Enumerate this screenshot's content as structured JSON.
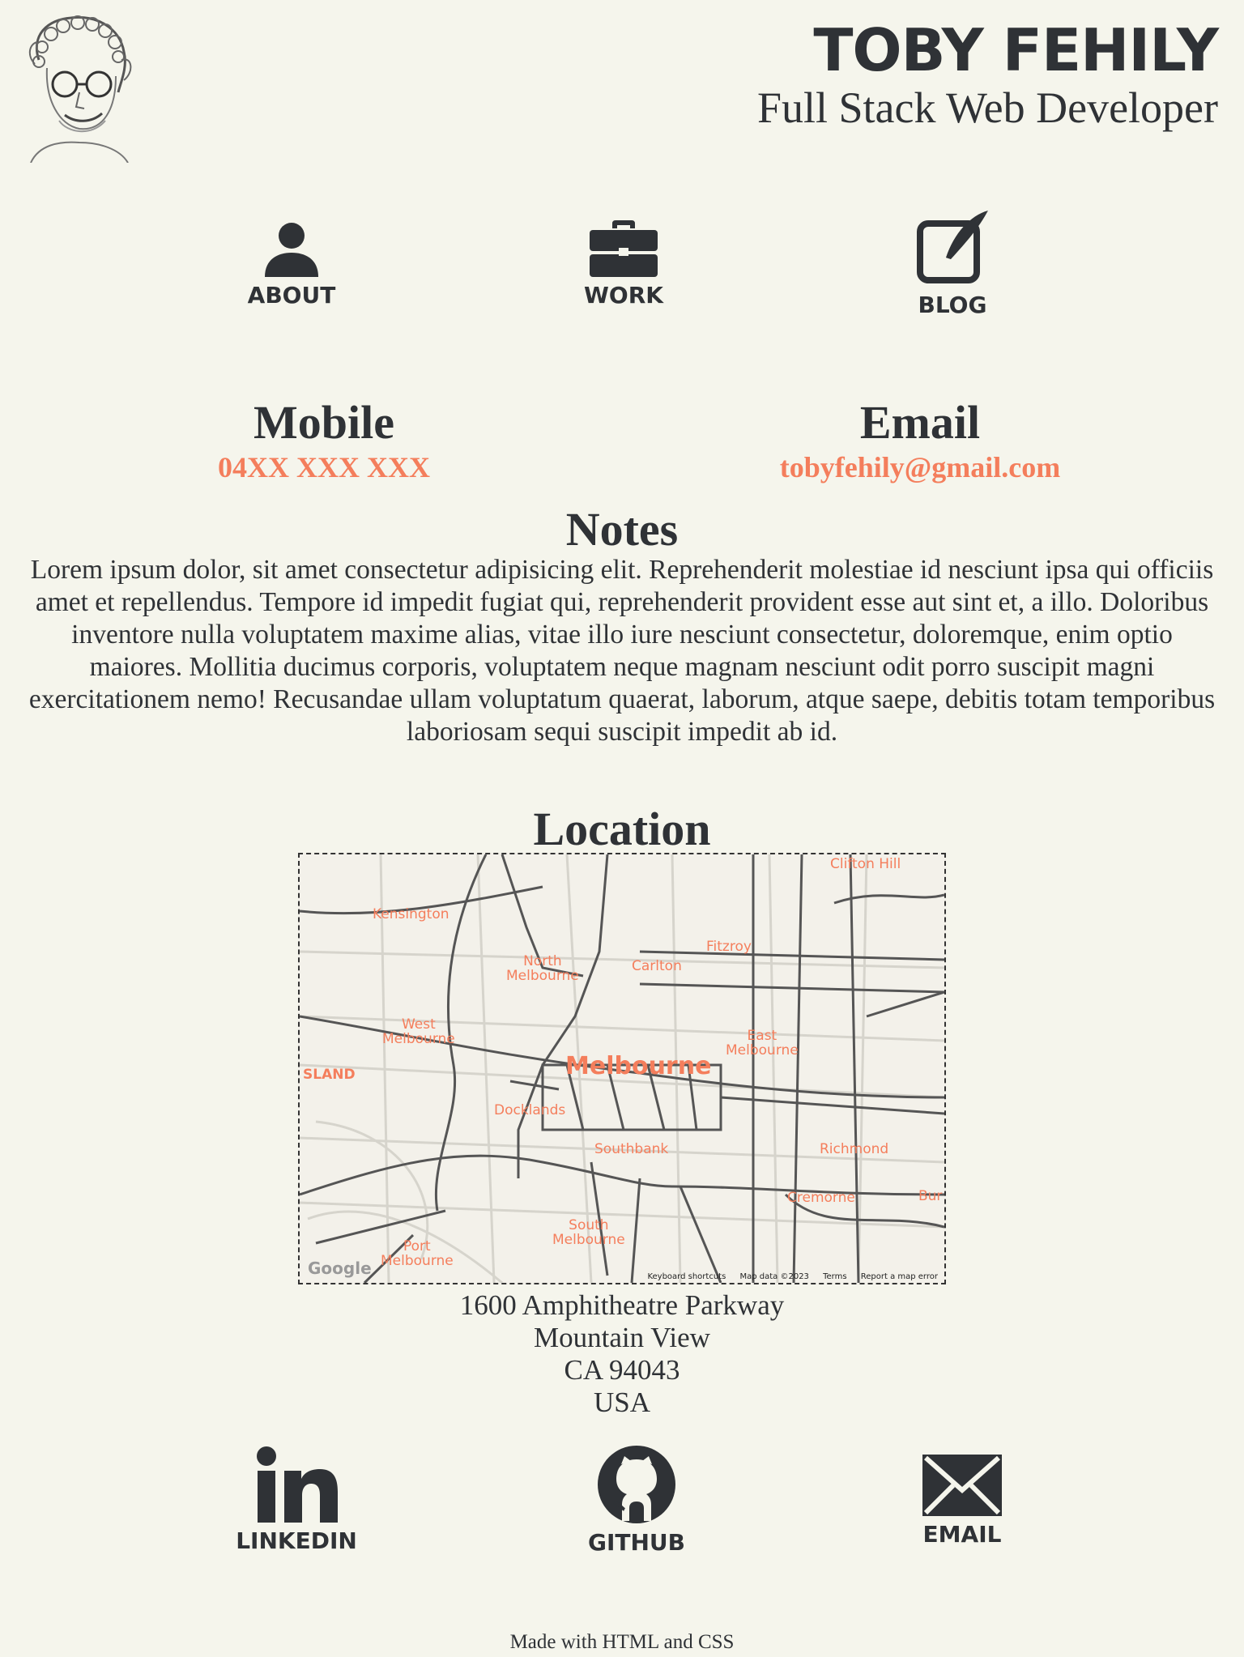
{
  "header": {
    "name": "TOBY FEHILY",
    "subtitle": "Full Stack Web Developer",
    "avatar_icon": "portrait-sketch"
  },
  "nav": {
    "items": [
      {
        "label": "ABOUT",
        "icon": "user-icon"
      },
      {
        "label": "WORK",
        "icon": "briefcase-icon"
      },
      {
        "label": "BLOG",
        "icon": "pen-square-icon"
      }
    ]
  },
  "contact": {
    "mobile_heading": "Mobile",
    "mobile_value": "04XX XXX XXX",
    "email_heading": "Email",
    "email_value": "tobyfehily@gmail.com"
  },
  "notes": {
    "heading": "Notes",
    "text": "Lorem ipsum dolor, sit amet consectetur adipisicing elit. Reprehenderit molestiae id nesciunt ipsa qui officiis amet et repellendus. Tempore id impedit fugiat qui, reprehenderit provident esse aut sint et, a illo. Doloribus inventore nulla voluptatem maxime alias, vitae illo iure nesciunt consectetur, doloremque, enim optio maiores. Mollitia ducimus corporis, voluptatem neque magnam nesciunt odit porro suscipit magni exercitationem nemo! Recusandae ullam voluptatum quaerat, laborum, atque saepe, debitis totam temporibus laboriosam sequi suscipit impedit ab id."
  },
  "location": {
    "heading": "Location",
    "map": {
      "labels": {
        "clifton_hill": "Clifton Hill",
        "kensington": "Kensington",
        "north_melbourne": "North\nMelbourne",
        "carlton": "Carlton",
        "fitzroy": "Fitzroy",
        "west_melbourne": "West\nMelbourne",
        "east_melbourne": "East\nMelbourne",
        "island": "SLAND",
        "melbourne": "Melbourne",
        "docklands": "Docklands",
        "southbank": "Southbank",
        "richmond": "Richmond",
        "cremorne": "Cremorne",
        "burnley": "Bur",
        "south_melbourne": "South\nMelbourne",
        "port_melbourne": "Port\nMelbourne"
      },
      "google_logo": "Google",
      "footer": {
        "shortcuts": "Keyboard shortcuts",
        "map_data": "Map data ©2023",
        "terms": "Terms",
        "report": "Report a map error"
      }
    },
    "address": {
      "line1": "1600 Amphitheatre Parkway",
      "line2": "Mountain View",
      "line3": "CA 94043",
      "line4": "USA"
    }
  },
  "social": {
    "items": [
      {
        "label": "LINKEDIN",
        "icon": "linkedin-icon"
      },
      {
        "label": "GITHUB",
        "icon": "github-icon"
      },
      {
        "label": "EMAIL",
        "icon": "envelope-icon"
      }
    ]
  },
  "footer": {
    "text": "Made with HTML and CSS"
  },
  "colors": {
    "background": "#f5f5ec",
    "text": "#2f3236",
    "accent": "#f47e5c"
  }
}
